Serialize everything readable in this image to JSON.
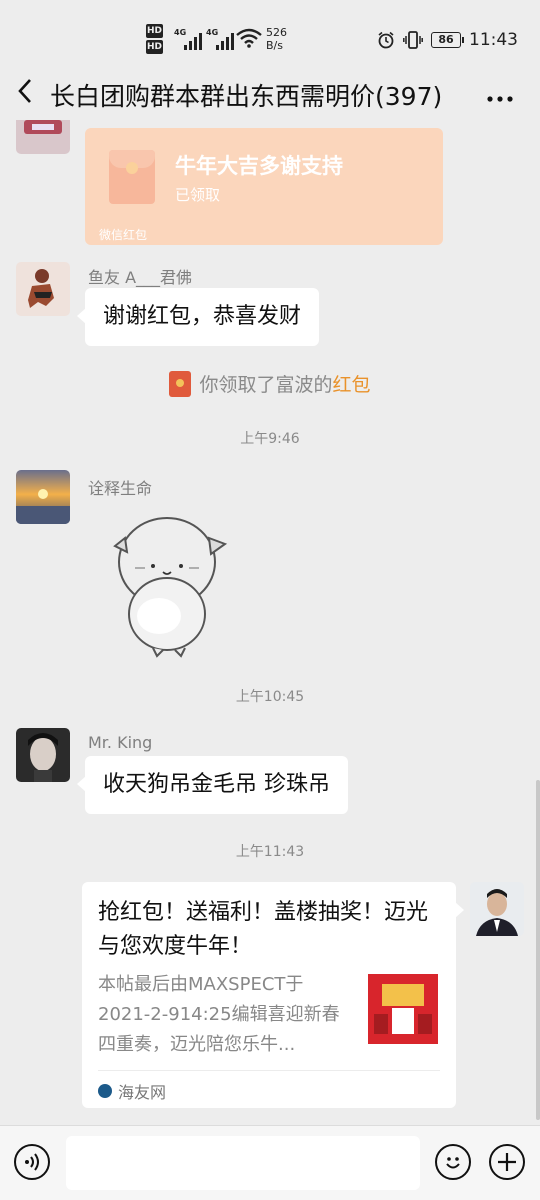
{
  "status_bar": {
    "hd1": "HD",
    "hd2": "HD",
    "sig1": "4G",
    "sig2": "4G",
    "net_speed": "526",
    "net_unit": "B/s",
    "battery": "86",
    "time": "11:43"
  },
  "header": {
    "back_icon": "chevron-left-icon",
    "title": "长白团购群本群出东西需明价(397)",
    "more_icon": "more-dots-icon"
  },
  "messages": {
    "red_packet": {
      "title": "牛年大吉多谢支持",
      "status": "已领取",
      "footer": "微信红包"
    },
    "msg1": {
      "nick": "鱼友 A___君佛",
      "text": "谢谢红包，恭喜发财"
    },
    "system": {
      "prefix": "你领取了富波的",
      "link": "红包"
    },
    "time1": "上午9:46",
    "msg2": {
      "nick": "诠释生命"
    },
    "time2": "上午10:45",
    "msg3": {
      "nick": "Mr. King",
      "text": "收天狗吊金毛吊 珍珠吊"
    },
    "time3": "上午11:43",
    "link_card": {
      "title": "抢红包！送福利！盖楼抽奖！迈光与您欢度牛年！",
      "desc": "本帖最后由MAXSPECT于2021-2-914:25编辑喜迎新春四重奏，迈光陪您乐牛...",
      "source": "海友网"
    }
  },
  "input_bar": {
    "voice_icon": "voice-icon",
    "emoji_icon": "emoji-icon",
    "plus_icon": "plus-icon"
  },
  "colors": {
    "background": "#ededed",
    "red_packet": "#fbd6bc",
    "link_orange": "#e9922b"
  }
}
